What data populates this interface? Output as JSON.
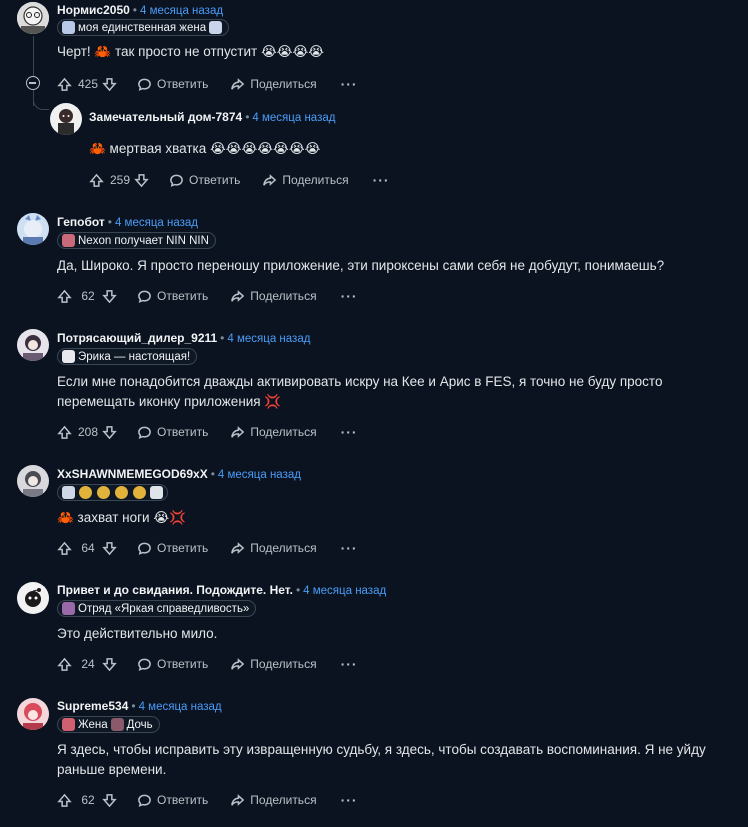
{
  "comments": [
    {
      "author": "Нормис2050",
      "time": "4 месяца назад",
      "flair": "моя единственная жена",
      "body": [
        "Черт! 🦀 так просто не отпустит 😭😭😭😭"
      ],
      "score": "425",
      "reply_label": "Ответить",
      "share_label": "Поделиться"
    },
    {
      "author": "Замечательный дом-7874",
      "time": "4 месяца назад",
      "flair": "",
      "body": [
        "🦀 мертвая хватка 😭😭😭😭😭😭😭"
      ],
      "score": "259",
      "reply_label": "Ответить",
      "share_label": "Поделиться"
    },
    {
      "author": "Гепобот",
      "time": "4 месяца назад",
      "flair": "Nexon получает NIN NIN",
      "body": [
        "Да, Широко. Я просто переношу приложение, эти пироксены сами себя не добудут, понимаешь?"
      ],
      "score": "62",
      "reply_label": "Ответить",
      "share_label": "Поделиться"
    },
    {
      "author": "Потрясающий_дилер_9211",
      "time": "4 месяца назад",
      "flair": "Эрика — настоящая!",
      "body": [
        "Если мне понадобится дважды активировать искру на Кее и Арис в FES, я точно не буду просто",
        "перемещать иконку приложения 💢"
      ],
      "score": "208",
      "reply_label": "Ответить",
      "share_label": "Поделиться"
    },
    {
      "author": "XxSHAWNMEMEGOD69xX",
      "time": "4 месяца назад",
      "flair": "",
      "body": [
        "🦀 захват ноги 😭💢"
      ],
      "score": "64",
      "reply_label": "Ответить",
      "share_label": "Поделиться"
    },
    {
      "author": "Привет и до свидания. Подождите. Нет.",
      "time": "4 месяца назад",
      "flair": "Отряд «Яркая справедливость»",
      "body": [
        "Это действительно мило."
      ],
      "score": "24",
      "reply_label": "Ответить",
      "share_label": "Поделиться"
    },
    {
      "author": "Supreme534",
      "time": "4 месяца назад",
      "flair": "Жена",
      "flair2": "Дочь",
      "body": [
        "Я здесь, чтобы исправить эту извращенную судьбу, я здесь, чтобы создавать воспоминания. Я не уйду",
        "раньше времени."
      ],
      "score": "62",
      "reply_label": "Ответить",
      "share_label": "Поделиться"
    }
  ],
  "colors": {
    "background": "#0b1320",
    "time_link": "#4a9cf7",
    "text": "#e3e6e8",
    "muted": "#b9c1c8"
  }
}
